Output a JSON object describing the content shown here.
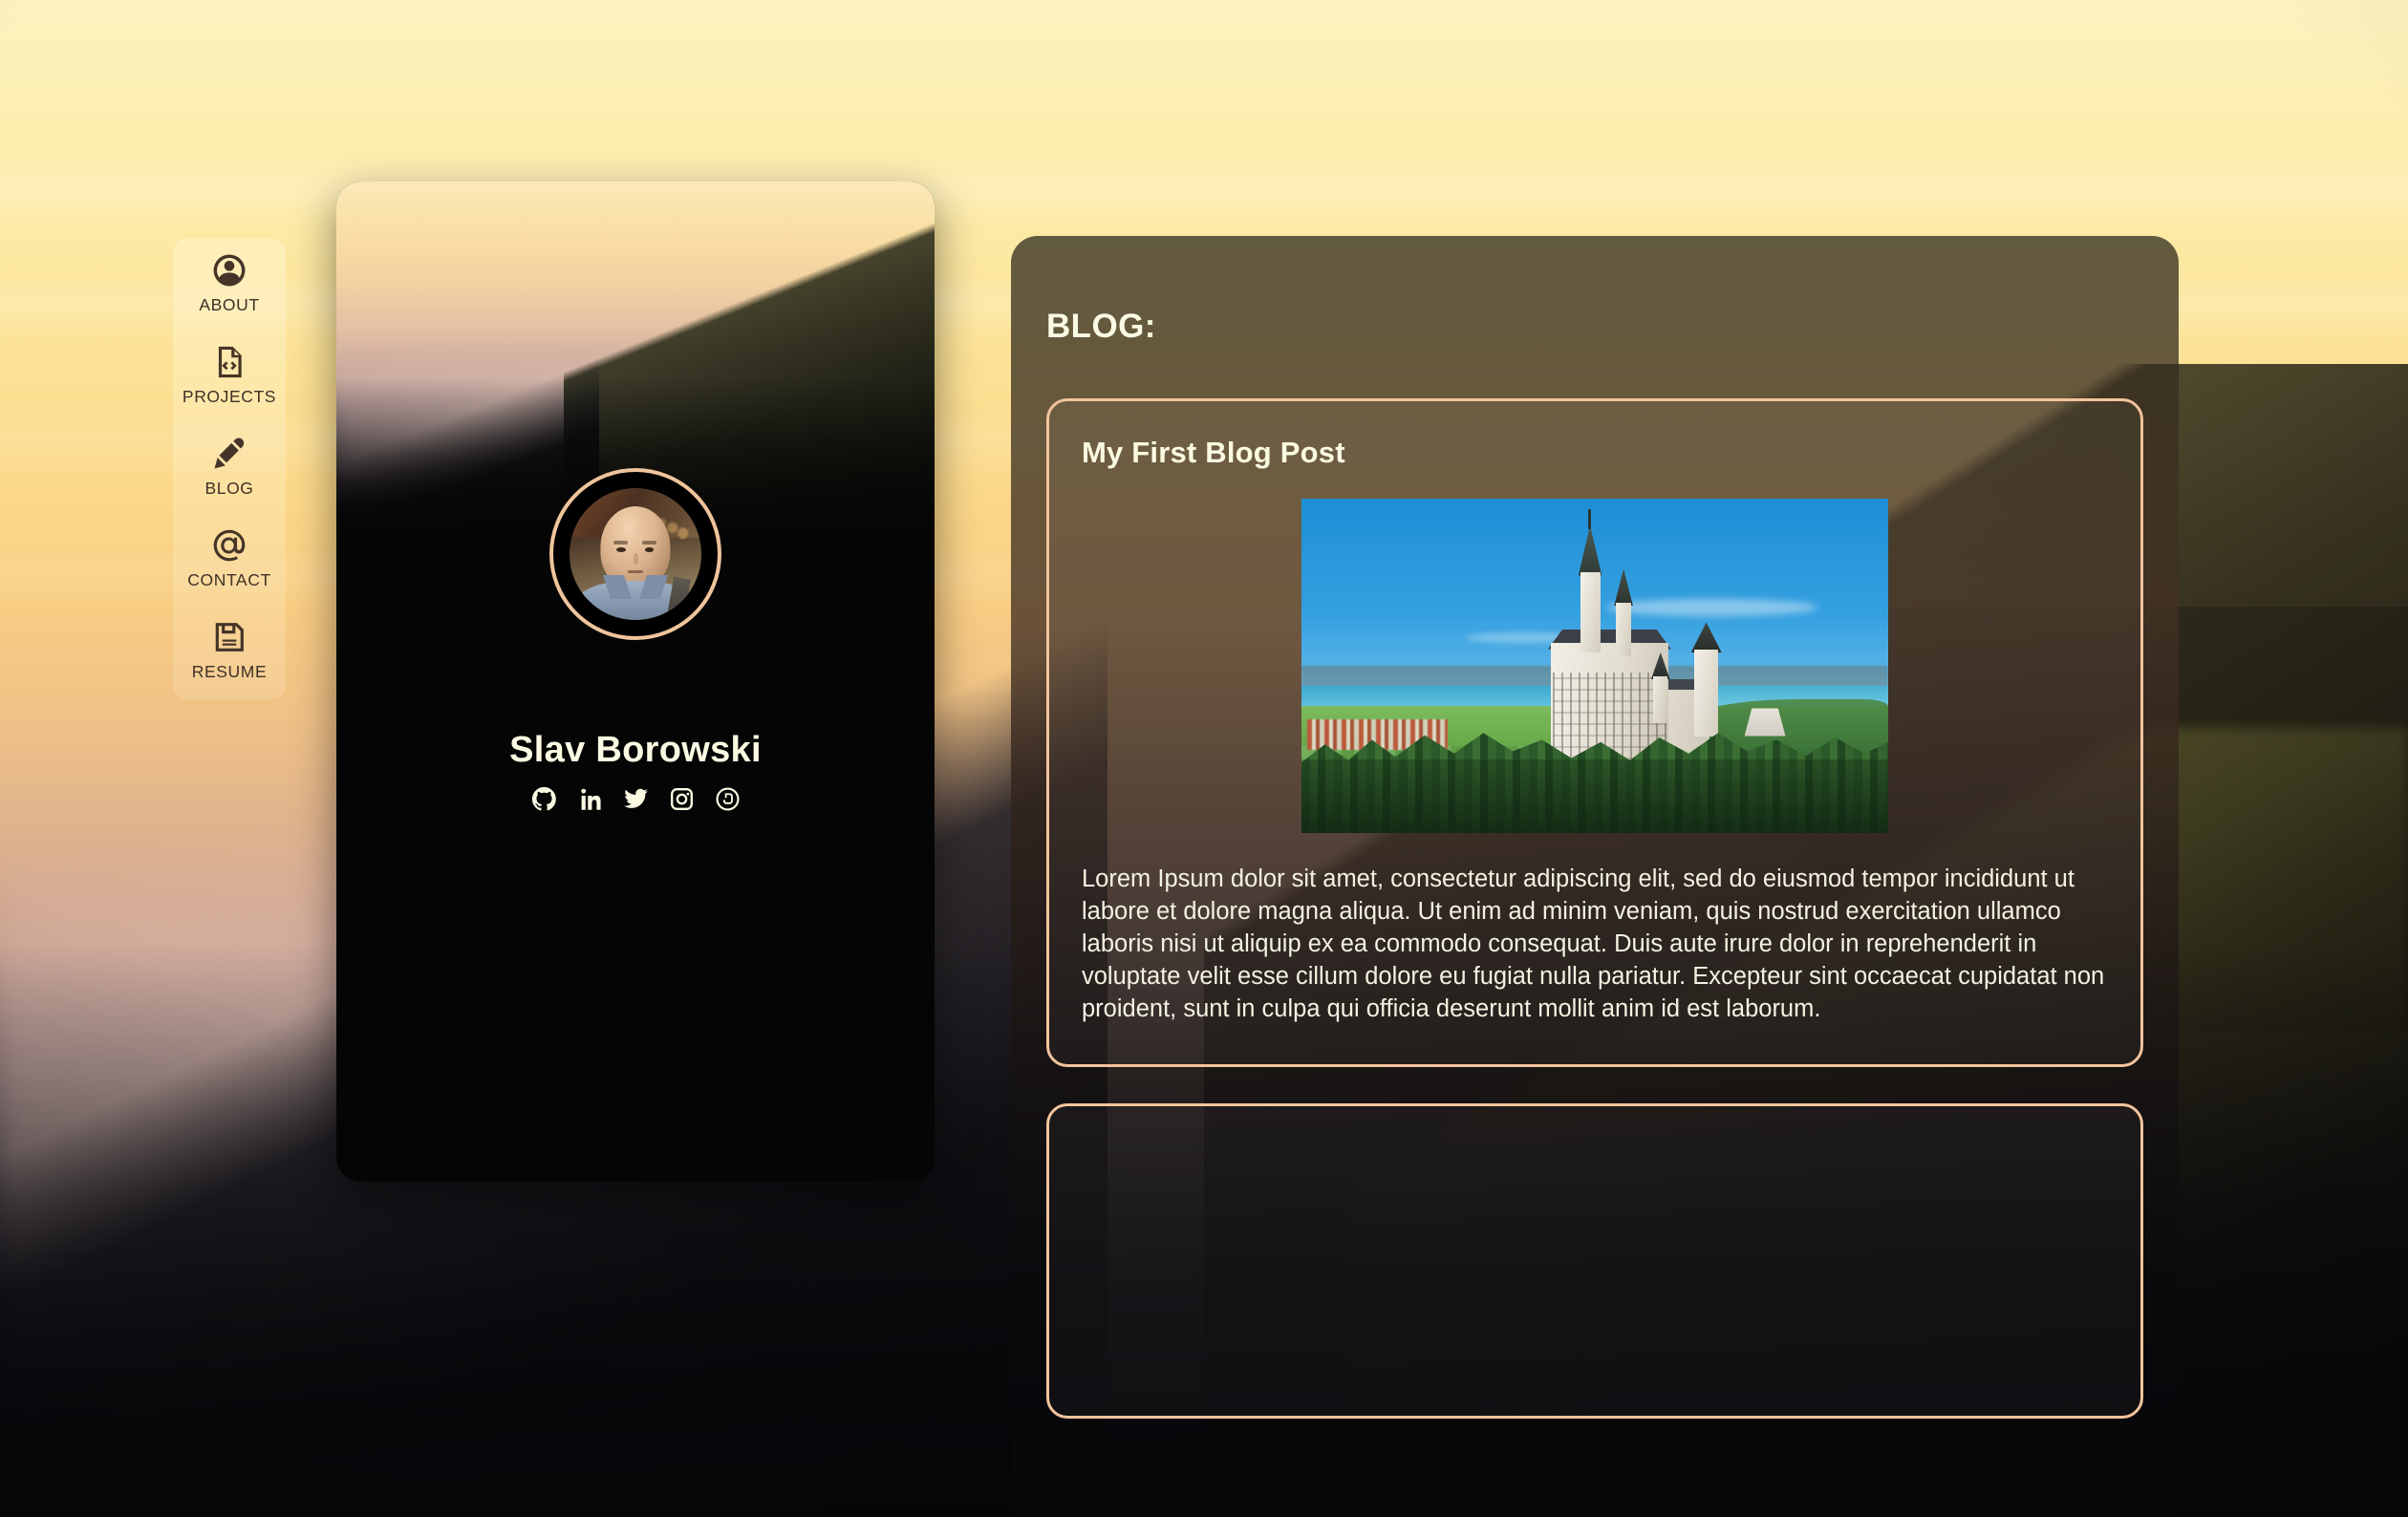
{
  "sidebar": {
    "items": [
      {
        "label": "ABOUT",
        "icon": "user-circle-icon"
      },
      {
        "label": "PROJECTS",
        "icon": "code-file-icon"
      },
      {
        "label": "BLOG",
        "icon": "pen-icon"
      },
      {
        "label": "CONTACT",
        "icon": "at-sign-icon"
      },
      {
        "label": "RESUME",
        "icon": "floppy-disk-icon"
      }
    ]
  },
  "profile": {
    "name": "Slav Borowski",
    "avatar_alt": "portrait-photo",
    "socials": [
      {
        "name": "github-icon"
      },
      {
        "name": "linkedin-icon"
      },
      {
        "name": "twitter-icon"
      },
      {
        "name": "instagram-icon"
      },
      {
        "name": "500px-icon"
      }
    ]
  },
  "blog": {
    "heading": "BLOG:",
    "posts": [
      {
        "title": "My First Blog Post",
        "image_alt": "neuschwanstein-castle-photo",
        "body": "Lorem Ipsum dolor sit amet, consectetur adipiscing elit, sed do eiusmod tempor incididunt ut labore et dolore magna aliqua. Ut enim ad minim veniam, quis nostrud exercitation ullamco laboris nisi ut aliquip ex ea commodo consequat. Duis aute irure dolor in reprehenderit in voluptate velit esse cillum dolore eu fugiat nulla pariatur. Excepteur sint occaecat cupidatat non proident, sunt in culpa qui officia deserunt mollit anim id est laborum."
      },
      {
        "title": "",
        "body": ""
      }
    ]
  },
  "colors": {
    "accent_peach": "#F3C49C",
    "text_cream": "#FBFBE3",
    "nav_text": "#3F3126",
    "card_black": "#050505"
  }
}
